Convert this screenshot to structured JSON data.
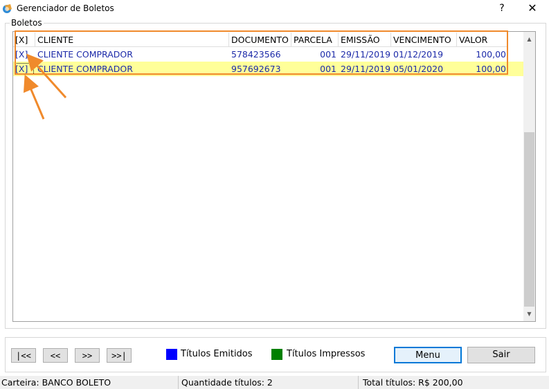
{
  "window": {
    "title": "Gerenciador de Boletos",
    "help_label": "?",
    "close_label": "✕"
  },
  "group": {
    "label": "Boletos"
  },
  "grid": {
    "columns": [
      "[X]",
      "CLIENTE",
      "DOCUMENTO",
      "PARCELA",
      "EMISSÃO",
      "VENCIMENTO",
      "VALOR"
    ],
    "rows": [
      {
        "select": "[X]",
        "cliente": "CLIENTE COMPRADOR",
        "documento": "578423566",
        "parcela": "001",
        "emissao": "29/11/2019",
        "vencimento": "01/12/2019",
        "valor": "100,00"
      },
      {
        "select": "[X]",
        "cliente": "CLIENTE COMPRADOR",
        "documento": "957692673",
        "parcela": "001",
        "emissao": "29/11/2019",
        "vencimento": "05/01/2020",
        "valor": "100,00"
      }
    ],
    "selected_row_color": "#ffff99",
    "row_text_color": "#1c2aa8"
  },
  "annotation": {
    "color": "#f08a2c"
  },
  "navigation": {
    "first": "|<<",
    "prev": "<<",
    "next": ">>",
    "last": ">>|"
  },
  "legend": [
    {
      "label": "Títulos Emitidos",
      "color": "#0000ff"
    },
    {
      "label": "Títulos Impressos",
      "color": "#008000"
    }
  ],
  "actions": {
    "menu": "Menu",
    "sair": "Sair"
  },
  "status": {
    "carteira": "Carteira: BANCO BOLETO",
    "quantidade": "Quantidade títulos: 2",
    "total": "Total títulos: R$ 200,00"
  },
  "icons": {
    "app": "boleto-app-icon",
    "scroll_up": "scroll-up-icon",
    "scroll_down": "scroll-down-icon"
  }
}
